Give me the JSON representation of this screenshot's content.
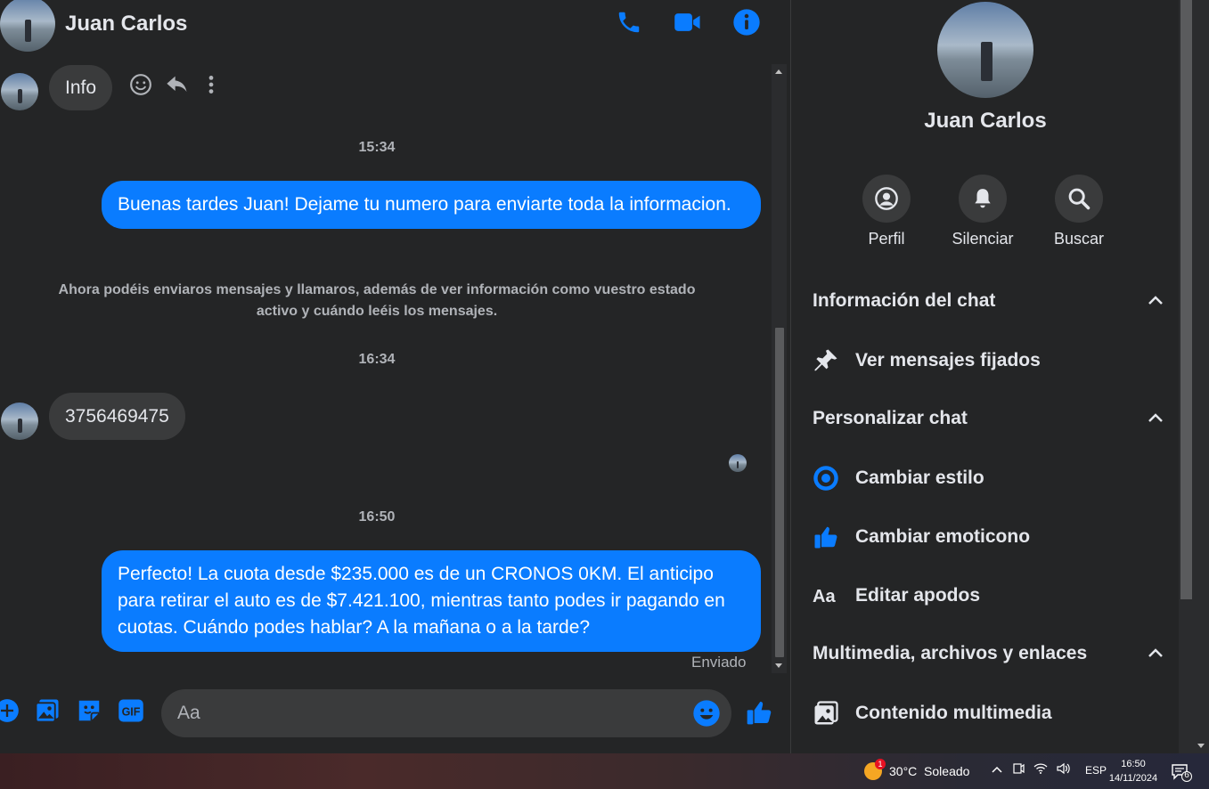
{
  "contact": {
    "name": "Juan Carlos"
  },
  "header": {
    "call_icon": "phone-icon",
    "video_icon": "video-icon",
    "info_icon": "info-icon"
  },
  "messages": {
    "hover_bubble": "Info",
    "time_1": "15:34",
    "out_1": "Buenas tardes Juan! Dejame tu numero para enviarte toda la informacion.",
    "system": "Ahora podéis enviaros mensajes y llamaros, además de ver información como vuestro estado activo y cuándo leéis los mensajes.",
    "time_2": "16:34",
    "in_1": "3756469475",
    "time_3": "16:50",
    "out_2": "Perfecto! La cuota desde $235.000 es de un CRONOS 0KM. El anticipo para retirar el auto es de $7.421.100, mientras tanto podes ir pagando en cuotas. Cuándo podes hablar? A la mañana o a la tarde?",
    "status": "Enviado"
  },
  "composer": {
    "placeholder": "Aa"
  },
  "side": {
    "name": "Juan Carlos",
    "actions": [
      {
        "label": "Perfil",
        "icon": "profile-icon"
      },
      {
        "label": "Silenciar",
        "icon": "bell-icon"
      },
      {
        "label": "Buscar",
        "icon": "search-icon"
      }
    ],
    "sections": {
      "chat_info": "Información del chat",
      "pinned": "Ver mensajes fijados",
      "customize": "Personalizar chat",
      "style": "Cambiar estilo",
      "emoji": "Cambiar emoticono",
      "nicknames": "Editar apodos",
      "media_files": "Multimedia, archivos y enlaces",
      "media": "Contenido multimedia"
    }
  },
  "taskbar": {
    "weather": "30°C  Soleado",
    "weather_badge": "1",
    "lang": "ESP",
    "time": "16:50",
    "date": "14/11/2024",
    "notif_count": "6"
  },
  "colors": {
    "accent": "#0a7cff",
    "bg": "#242526",
    "bubble_in": "#3a3b3c"
  }
}
